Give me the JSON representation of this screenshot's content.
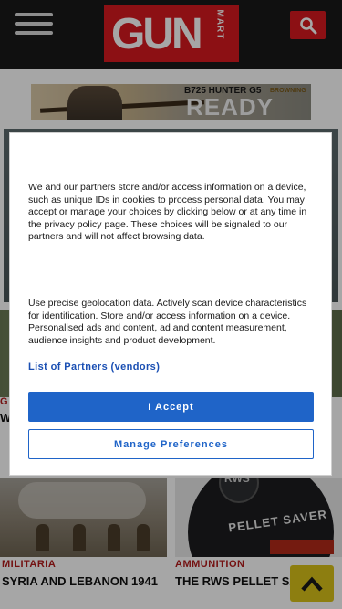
{
  "header": {
    "logo_text": "GUN",
    "logo_subtext": "MART"
  },
  "ad": {
    "model": "B725 HUNTER G5",
    "headline": "READY",
    "brand": "BROWNING"
  },
  "background": {
    "partial_category": "G",
    "partial_headline": "W"
  },
  "cards": [
    {
      "category": "MILITARIA",
      "title": "SYRIA AND LEBANON 1941"
    },
    {
      "category": "AMMUNITION",
      "title": "THE RWS PELLET SAVER",
      "image_text": "PELLET SAVER",
      "image_logo": "RWS"
    }
  ],
  "consent": {
    "paragraph1": "We and our partners store and/or access information on a device, such as unique IDs in cookies to process personal data. You may accept or manage your choices by clicking below or at any time in the privacy policy page. These choices will be signaled to our partners and will not affect browsing data.",
    "paragraph2": "Use precise geolocation data. Actively scan device characteristics for identification. Store and/or access information on a device. Personalised ads and content, ad and content measurement, audience insights and product development.",
    "partners_link": "List of Partners (vendors)",
    "accept_label": "I Accept",
    "manage_label": "Manage Preferences"
  },
  "colors": {
    "brand_red": "#d71920",
    "accent_blue": "#1f64c8",
    "category_red": "#b31b1b",
    "scroll_yellow": "#d9c21a"
  }
}
